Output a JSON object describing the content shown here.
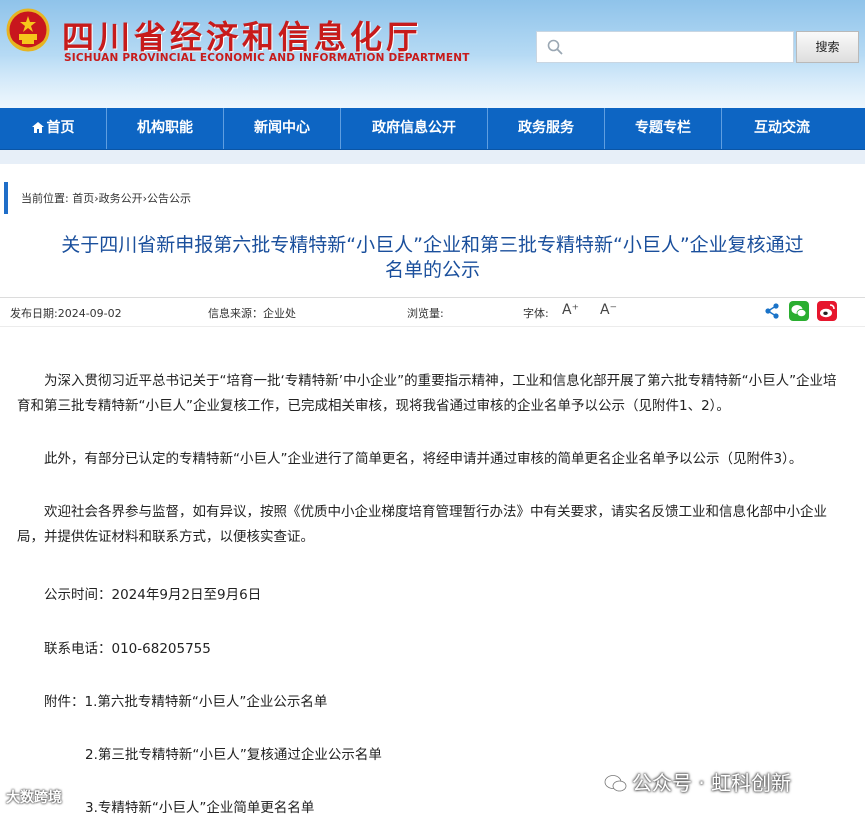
{
  "header": {
    "title": "四川省经济和信息化厅",
    "subtitle": "SICHUAN PROVINCIAL ECONOMIC AND INFORMATION DEPARTMENT",
    "search_placeholder": "",
    "search_button": "搜索",
    "accent_color": "#c71b1b"
  },
  "nav": {
    "items": [
      {
        "label": "首页",
        "icon": "home-icon"
      },
      {
        "label": "机构职能"
      },
      {
        "label": "新闻中心"
      },
      {
        "label": "政府信息公开"
      },
      {
        "label": "政务服务"
      },
      {
        "label": "专题专栏"
      },
      {
        "label": "互动交流"
      }
    ],
    "color": "#0d65c3"
  },
  "breadcrumb": {
    "label": "当前位置:",
    "items": [
      "首页",
      "政务公开",
      "公告公示"
    ],
    "text": "首页›政务公开›公告公示"
  },
  "article": {
    "title_line1": "关于四川省新申报第六批专精特新“小巨人”企业和第三批专精特新“小巨人”企业复核通过",
    "title_line2": "名单的公示",
    "meta": {
      "date": "发布日期:2024-09-02",
      "source": "信息来源：企业处",
      "views": "浏览量:",
      "font_label": "字体:",
      "font_increase": "A⁺",
      "font_decrease": "A⁻"
    },
    "paragraphs": [
      "为深入贯彻习近平总书记关于“培育一批‘专精特新’中小企业”的重要指示精神，工业和信息化部开展了第六批专精特新“小巨人”企业培育和第三批专精特新“小巨人”企业复核工作，已完成相关审核，现将我省通过审核的企业名单予以公示（见附件1、2）。",
      "此外，有部分已认定的专精特新“小巨人”企业进行了简单更名，将经申请并通过审核的简单更名企业名单予以公示（见附件3）。",
      "欢迎社会各界参与监督，如有异议，按照《优质中小企业梯度培育管理暂行办法》中有关要求，请实名反馈工业和信息化部中小企业局，并提供佐证材料和联系方式，以便核实查证。"
    ],
    "publicity_time": "公示时间：2024年9月2日至9月6日",
    "contact": "联系电话：010-68205755",
    "attachments": {
      "label": "附件：",
      "items": [
        "1.第六批专精特新“小巨人”企业公示名单",
        "2.第三批专精特新“小巨人”复核通过企业公示名单",
        "3.专精特新“小巨人”企业简单更名名单"
      ]
    }
  },
  "watermark": {
    "left": "大数跨境",
    "right": "公众号 · 虹科创新"
  }
}
